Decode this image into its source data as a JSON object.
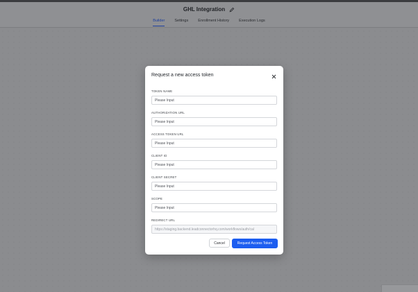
{
  "header": {
    "title": "GHL Integration",
    "tabs": [
      {
        "label": "Builder"
      },
      {
        "label": "Settings"
      },
      {
        "label": "Enrollment History"
      },
      {
        "label": "Execution Logs"
      }
    ]
  },
  "modal": {
    "title": "Request a new access token",
    "fields": [
      {
        "label": "TOKEN NAME",
        "placeholder": "Please Input"
      },
      {
        "label": "AUTHORIZATION URL",
        "placeholder": "Please Input"
      },
      {
        "label": "ACCESS TOKEN URL",
        "placeholder": "Please Input"
      },
      {
        "label": "CLIENT ID",
        "placeholder": "Please Input"
      },
      {
        "label": "CLIENT SECRET",
        "placeholder": "Please Input"
      },
      {
        "label": "SCOPE",
        "placeholder": "Please Input"
      },
      {
        "label": "REDIRECT URL",
        "value": "https://staging.backend.leadconnectorhq.com/workflows/auth/cal"
      }
    ],
    "cancel_label": "Cancel",
    "submit_label": "Request Access Token"
  },
  "colors": {
    "accent": "#1d5ef0",
    "overlay": "#8b8c8f"
  }
}
